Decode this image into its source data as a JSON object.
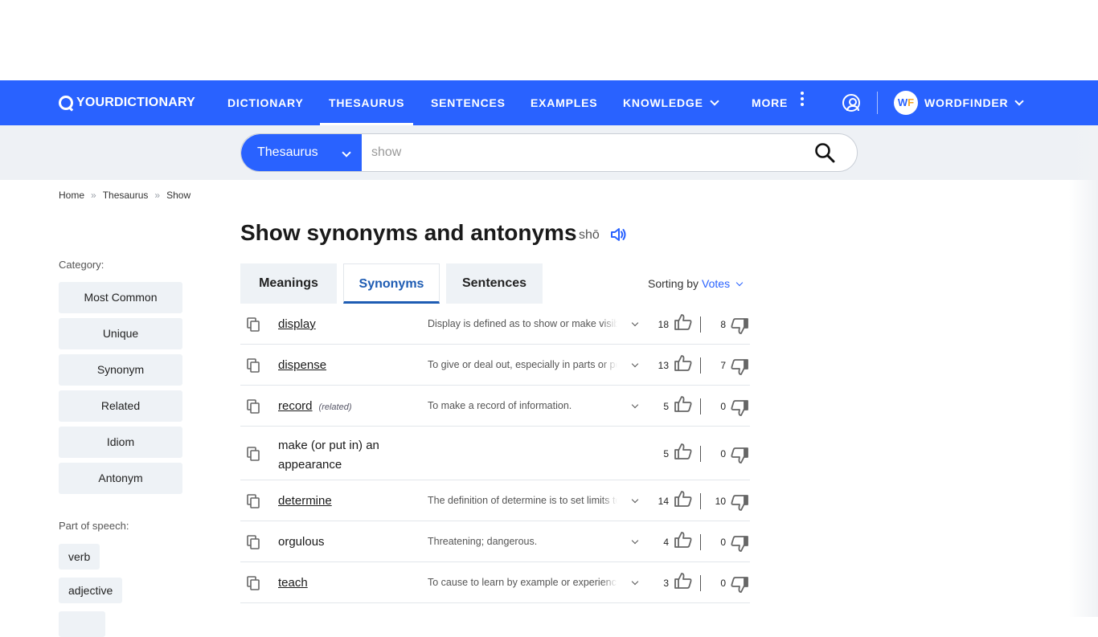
{
  "nav": {
    "logo": "YOURDICTIONARY",
    "items": [
      {
        "label": "DICTIONARY"
      },
      {
        "label": "THESAURUS"
      },
      {
        "label": "SENTENCES"
      },
      {
        "label": "EXAMPLES"
      },
      {
        "label": "KNOWLEDGE"
      },
      {
        "label": "MORE"
      }
    ],
    "wordfinder_label": "WORDFINDER",
    "wordfinder_logo_w": "W",
    "wordfinder_logo_f": "F",
    "accent_color": "#2962ff"
  },
  "search": {
    "category": "Thesaurus",
    "value": "show",
    "placeholder": "show"
  },
  "breadcrumb": {
    "home": "Home",
    "thesaurus": "Thesaurus",
    "current": "Show",
    "separator": "»"
  },
  "title": "Show synonyms and antonyms",
  "pronunciation": "shō",
  "sidebar": {
    "category_label": "Category:",
    "categories": [
      "Most Common",
      "Unique",
      "Synonym",
      "Related",
      "Idiom",
      "Antonym"
    ],
    "pos_label": "Part of speech:",
    "parts_of_speech": [
      "verb",
      "adjective"
    ]
  },
  "tabs": [
    "Meanings",
    "Synonyms",
    "Sentences"
  ],
  "sorting": {
    "label": "Sorting by",
    "value": "Votes"
  },
  "rows": [
    {
      "word": "display",
      "tag": "",
      "definition": "Display is defined as to show or make visible.",
      "up": "18",
      "down": "8"
    },
    {
      "word": "dispense",
      "tag": "",
      "definition": "To give or deal out, especially in parts or portions.",
      "up": "13",
      "down": "7"
    },
    {
      "word": "record",
      "tag": "(related)",
      "definition": "To make a record of information.",
      "up": "5",
      "down": "0"
    },
    {
      "word": "make (or put in) an appearance",
      "tag": "",
      "definition": "",
      "up": "5",
      "down": "0"
    },
    {
      "word": "determine",
      "tag": "",
      "definition": "The definition of determine is to set limits to.",
      "up": "14",
      "down": "10"
    },
    {
      "word": "orgulous",
      "tag": "",
      "definition": "Threatening; dangerous.",
      "up": "4",
      "down": "0"
    },
    {
      "word": "teach",
      "tag": "",
      "definition": "To cause to learn by example or experience.",
      "up": "3",
      "down": "0"
    }
  ]
}
